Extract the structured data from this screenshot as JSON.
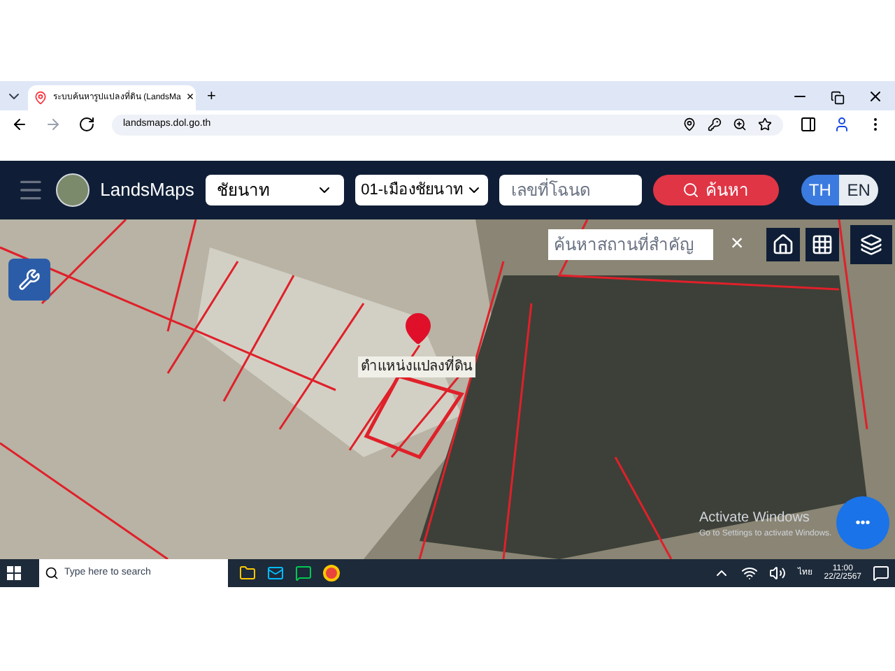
{
  "browser": {
    "tab_title": "ระบบค้นหารูปแปลงที่ดิน (LandsMa",
    "close_tab": "×",
    "new_tab": "+",
    "url": "landsmaps.dol.go.th"
  },
  "header": {
    "brand": "LandsMaps",
    "province": "ชัยนาท",
    "district": "01-เมืองชัยนาท",
    "deed_placeholder": "เลขที่โฉนด",
    "search_button": "ค้นหา",
    "languages": [
      {
        "label": "TH",
        "selected": true
      },
      {
        "label": "EN",
        "selected": false
      }
    ]
  },
  "map": {
    "place_search_placeholder": "ค้นหาสถานที่สำคัญ",
    "clear": "×",
    "marker_label": "ตำแหน่งแปลงที่ดิน",
    "more": "•••"
  },
  "activation": {
    "title": "Activate Windows",
    "subtitle": "Go to Settings to activate Windows."
  },
  "taskbar": {
    "search_placeholder": "Type here to search",
    "language": "ไทย",
    "time": "11:00",
    "date": "22/2/2567"
  }
}
